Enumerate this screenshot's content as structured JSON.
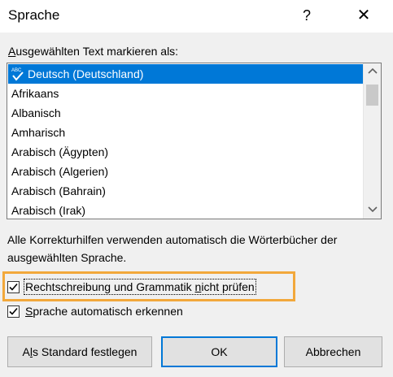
{
  "window": {
    "title": "Sprache",
    "help_label": "?",
    "close_label": "✕"
  },
  "section": {
    "label_underlined": "A",
    "label_rest": "usgewählten Text markieren als:"
  },
  "languages": {
    "items": [
      {
        "label": "Deutsch (Deutschland)",
        "selected": true,
        "icon": "spell-check-icon"
      },
      {
        "label": "Afrikaans"
      },
      {
        "label": "Albanisch"
      },
      {
        "label": "Amharisch"
      },
      {
        "label": "Arabisch (Ägypten)"
      },
      {
        "label": "Arabisch (Algerien)"
      },
      {
        "label": "Arabisch (Bahrain)"
      },
      {
        "label": "Arabisch (Irak)"
      }
    ],
    "icon_badge": "ABC"
  },
  "info": {
    "text": "Alle Korrekturhilfen verwenden automatisch die Wörterbücher der ausgewählten Sprache."
  },
  "options": {
    "no_proofing": {
      "checked": true,
      "label_before": "Rechtschreibung und Grammatik ",
      "label_underlined": "n",
      "label_after": "icht prüfen"
    },
    "auto_detect": {
      "checked": true,
      "label_underlined": "S",
      "label_after": "prache automatisch erkennen"
    }
  },
  "buttons": {
    "set_default": {
      "before": "A",
      "underlined": "l",
      "after": "s Standard festlegen"
    },
    "ok": "OK",
    "cancel": "Abbrechen"
  },
  "colors": {
    "selection": "#0078d7",
    "highlight": "#f2a83b"
  }
}
